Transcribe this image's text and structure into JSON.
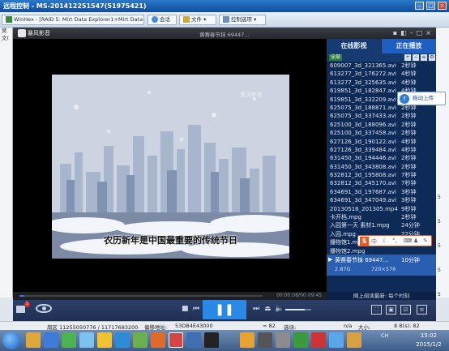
{
  "remote_window": {
    "title": "远程控制 - MS-201412251547(51975421)"
  },
  "background": {
    "winhex_tab": "WinHex - [RAID 5: Mirt Data Explorer1+Mirt Data Ex",
    "toolbar": {
      "chat": "会话",
      "file": "文件",
      "control": "控制选项"
    },
    "left_strip": [
      "窝",
      "文("
    ],
    "right_strip": [
      "5",
      "5",
      "5",
      "5",
      "5"
    ]
  },
  "player": {
    "app_name": "暴风影音",
    "title_file": "黄赛春节抹 69447...",
    "watermark": "黄河影音",
    "subtitle": "农历新年是中国最重要的传统节日",
    "time": "00:00:08/00:09:45",
    "progress_fraction": 0.02,
    "volume_fraction": 0.75,
    "tabs": {
      "online": "在线影视",
      "now_playing": "正在播放"
    },
    "filter_label": "全部",
    "playlist": [
      {
        "name": "609007_3d_321365.avi",
        "duration": "2秒钟"
      },
      {
        "name": "613277_3d_176272.avi",
        "duration": "4秒钟"
      },
      {
        "name": "613277_3d_325635.avi",
        "duration": "4秒钟"
      },
      {
        "name": "619851_3d_182847.avi",
        "duration": "4秒钟"
      },
      {
        "name": "619851_3d_332209.avi",
        "duration": "4秒钟"
      },
      {
        "name": "625075_3d_188871.avi",
        "duration": "2秒钟"
      },
      {
        "name": "625075_3d_337433.avi",
        "duration": "2秒钟"
      },
      {
        "name": "625100_3d_188096.avi",
        "duration": "2秒钟"
      },
      {
        "name": "625100_3d_337458.avi",
        "duration": "2秒钟"
      },
      {
        "name": "627126_3d_190122.avi",
        "duration": "4秒钟"
      },
      {
        "name": "627126_3d_339484.avi",
        "duration": "4秒钟"
      },
      {
        "name": "631450_3d_194446.avi",
        "duration": "2秒钟"
      },
      {
        "name": "631450_3d_343808.avi",
        "duration": "2秒钟"
      },
      {
        "name": "632812_3d_195808.avi",
        "duration": "7秒钟"
      },
      {
        "name": "632812_3d_345170.avi",
        "duration": "7秒钟"
      },
      {
        "name": "634691_3d_197687.avi",
        "duration": "3秒钟"
      },
      {
        "name": "634691_3d_347049.avi",
        "duration": "3秒钟"
      },
      {
        "name": "20130516_201305.mp4",
        "duration": "9秒钟"
      },
      {
        "name": "卡开档.mpg",
        "duration": "2秒钟"
      },
      {
        "name": "入园第一天 素材1.mpg",
        "duration": "24分钟"
      },
      {
        "name": "入园.mpg",
        "duration": "22分钟"
      },
      {
        "name": "播物馆1.mpg",
        "duration": "10分钟"
      },
      {
        "name": "播物馆2.mpg",
        "duration": ""
      }
    ],
    "now_playing": {
      "name": "黄赛春节抹 69447...",
      "duration": "10分钟",
      "size": "2.87G",
      "resolution": "720×576"
    },
    "footer": "网上阅读最新: 每个时刻",
    "upload_tip": "拖动上传",
    "ime": {
      "label": "中"
    }
  },
  "statusbar": {
    "sector": "扇区 11255050776 / 11717683200",
    "offset_label": "偏移地址:",
    "offset_value": "53DB4E43000",
    "eq": "= 82",
    "select": "选块:",
    "na": "n/a",
    "size": "大小:",
    "bytes": "8 B(s): 82"
  },
  "taskbar": {
    "time": "15:02",
    "date": "2015/1/2",
    "tray_lang": "CH"
  }
}
